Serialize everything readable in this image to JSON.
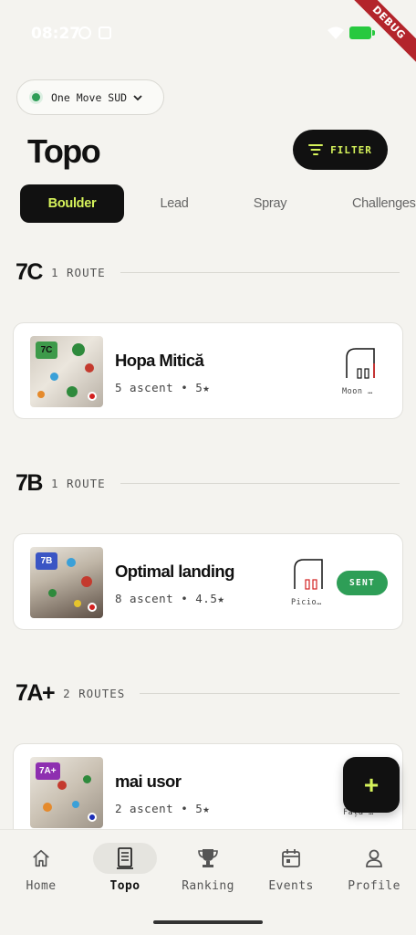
{
  "status_bar": {
    "time": "08:27",
    "debug_label": "DEBUG"
  },
  "gym": {
    "name": "One Move SUD"
  },
  "header": {
    "title": "Topo",
    "filter_label": "FILTER"
  },
  "tabs": [
    {
      "label": "Boulder",
      "active": true
    },
    {
      "label": "Lead",
      "active": false
    },
    {
      "label": "Spray",
      "active": false
    },
    {
      "label": "Challenges",
      "active": false
    }
  ],
  "sections": [
    {
      "grade": "7C",
      "count": "1 ROUTE",
      "routes": [
        {
          "name": "Hopa Mitică",
          "meta": "5 ascent • 5★",
          "badge": "7C",
          "badge_color": "#3d9a4a",
          "dot_color": "#d32020",
          "wall_name": "Moon …",
          "sent_label": ""
        }
      ]
    },
    {
      "grade": "7B",
      "count": "1 ROUTE",
      "routes": [
        {
          "name": "Optimal landing",
          "meta": "8 ascent • 4.5★",
          "badge": "7B",
          "badge_color": "#3a55c4",
          "dot_color": "#d32020",
          "wall_name": "Picio…",
          "sent_label": "SENT"
        }
      ]
    },
    {
      "grade": "7A+",
      "count": "2 ROUTES",
      "routes": [
        {
          "name": "mai usor",
          "meta": "2 ascent • 5★",
          "badge": "7A+",
          "badge_color": "#8e2fb0",
          "dot_color": "#1d2fb8",
          "wall_name": "Fața …",
          "sent_label": ""
        }
      ]
    }
  ],
  "fab": {
    "label": "+"
  },
  "nav": [
    {
      "label": "Home",
      "icon": "home-icon",
      "active": false
    },
    {
      "label": "Topo",
      "icon": "topo-icon",
      "active": true
    },
    {
      "label": "Ranking",
      "icon": "trophy-icon",
      "active": false
    },
    {
      "label": "Events",
      "icon": "calendar-icon",
      "active": false
    },
    {
      "label": "Profile",
      "icon": "person-icon",
      "active": false
    }
  ],
  "colors": {
    "accent": "#d6f35b",
    "sent": "#2e9e57",
    "background": "#f4f3ef"
  }
}
